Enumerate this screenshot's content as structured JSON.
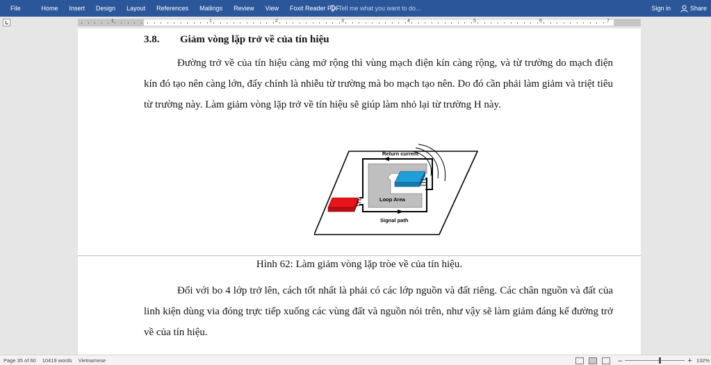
{
  "ribbon": {
    "tabs": [
      "File",
      "Home",
      "Insert",
      "Design",
      "Layout",
      "References",
      "Mailings",
      "Review",
      "View",
      "Foxit Reader PDF"
    ],
    "tell_me": "Tell me what you want to do...",
    "sign_in": "Sign in",
    "share": "Share"
  },
  "ruler": {
    "numbers": [
      "1",
      "1",
      "2",
      "3",
      "4",
      "5",
      "6",
      "7"
    ]
  },
  "document": {
    "heading_number": "3.8.",
    "heading_text": "Giảm vòng lặp trở về của tín hiệu",
    "paragraph_1": "Đường trở về của tín hiệu càng mở rộng thì vùng mạch điện kín càng rộng, và từ trường do mạch điện kín đó tạo nên càng lớn, đấy chính là nhiễu từ trường mà bo mạch tạo nên. Do đó cần phải làm giảm và triệt tiêu từ trường này. Làm giảm vòng lặp trở về tín hiệu sẽ giúp làm nhỏ lại từ trường H này.",
    "figure": {
      "return_label": "Return current",
      "loop_label": "Loop Area",
      "signal_label": "Signal path",
      "colors": {
        "red_chip": "#e8141c",
        "blue_chip": "#1e9fd8",
        "loop_area": "#bfbfbf"
      }
    },
    "caption": "Hình 62: Làm giảm vòng lặp tròe về của tín hiệu.",
    "paragraph_2": "Đối với bo 4 lớp trở lên, cách tốt nhất là phải có các lớp nguồn và đất riêng. Các chân nguồn và đất của linh kiện dùng via đóng trực tiếp xuống các vùng đất và nguồn nói trên, như vậy sẽ làm giảm đáng kể đường trở về của tín hiệu."
  },
  "status": {
    "page": "Page 35 of 60",
    "words": "10419 words",
    "language": "Vietnamese",
    "zoom": "132%",
    "zoom_minus": "–",
    "zoom_plus": "+"
  },
  "theme": {
    "ribbon": "#2b579a"
  }
}
